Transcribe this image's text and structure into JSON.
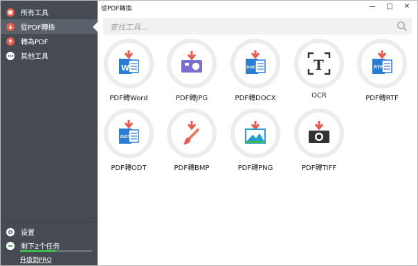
{
  "window": {
    "title": "從PDF轉換",
    "controls": {
      "minimize": "—",
      "maximize": "□",
      "close": "✕"
    }
  },
  "sidebar": {
    "items": [
      {
        "label": "所有工具",
        "icon": "all-tools-icon",
        "color": "#e85a4f",
        "active": false
      },
      {
        "label": "從PDF轉換",
        "icon": "from-pdf-icon",
        "color": "#e85a4f",
        "active": true
      },
      {
        "label": "轉為PDF",
        "icon": "to-pdf-icon",
        "color": "#e85a4f",
        "active": false
      },
      {
        "label": "其他工具",
        "icon": "more-icon",
        "color": "#ffffff",
        "active": false
      }
    ],
    "settings_label": "设置",
    "tasks_label": "剩下2个任务",
    "progress": 0.5,
    "upgrade_label": "升级到PRO"
  },
  "search": {
    "placeholder": "查找工具..."
  },
  "tools": [
    {
      "label": "PDF轉Word",
      "icon": "word-doc-icon",
      "badge": "W"
    },
    {
      "label": "PDF轉JPG",
      "icon": "jpg-image-icon",
      "badge": ""
    },
    {
      "label": "PDF轉DOCX",
      "icon": "docx-doc-icon",
      "badge": "DOCX"
    },
    {
      "label": "OCR",
      "icon": "ocr-icon",
      "badge": "T"
    },
    {
      "label": "PDF轉RTF",
      "icon": "rtf-doc-icon",
      "badge": "RTF"
    },
    {
      "label": "PDF轉ODT",
      "icon": "odt-doc-icon",
      "badge": "ODT"
    },
    {
      "label": "PDF轉BMP",
      "icon": "bmp-brush-icon",
      "badge": ""
    },
    {
      "label": "PDF轉PNG",
      "icon": "png-image-icon",
      "badge": ""
    },
    {
      "label": "PDF轉TIFF",
      "icon": "tiff-camera-icon",
      "badge": ""
    }
  ],
  "colors": {
    "sidebar_bg": "#464b53",
    "accent_red": "#e85a4f",
    "doc_blue": "#2b7cd3",
    "progress_green": "#3dba4e",
    "purple": "#7a6fd0"
  }
}
